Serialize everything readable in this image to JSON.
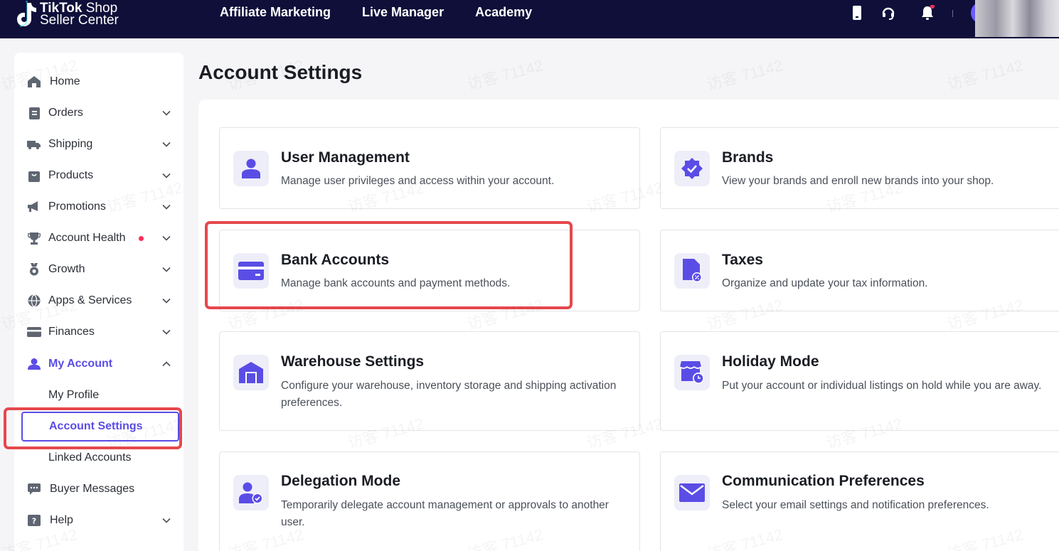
{
  "header": {
    "logo_line1_bold": "TikTok",
    "logo_line1_rest": " Shop",
    "logo_line2": "Seller Center",
    "nav": [
      "Affiliate Marketing",
      "Live Manager",
      "Academy"
    ],
    "icons": [
      "phone-icon",
      "headset-icon",
      "bell-icon"
    ],
    "colors": {
      "bar": "#0f0f3a",
      "accent": "#5a4de6",
      "alert": "#fe2c55"
    }
  },
  "sidebar": {
    "items": [
      {
        "label": "Home",
        "icon": "home-icon",
        "chevron": false
      },
      {
        "label": "Orders",
        "icon": "orders-icon",
        "chevron": "down"
      },
      {
        "label": "Shipping",
        "icon": "truck-icon",
        "chevron": "down"
      },
      {
        "label": "Products",
        "icon": "bag-icon",
        "chevron": "down"
      },
      {
        "label": "Promotions",
        "icon": "megaphone-icon",
        "chevron": "down"
      },
      {
        "label": "Account Health",
        "icon": "trophy-icon",
        "chevron": "down"
      },
      {
        "label": "Growth",
        "icon": "medal-icon",
        "chevron": "down"
      },
      {
        "label": "Apps & Services",
        "icon": "globe-icon",
        "chevron": "down"
      },
      {
        "label": "Finances",
        "icon": "card-icon",
        "chevron": "down"
      },
      {
        "label": "My Account",
        "icon": "user-icon",
        "chevron": "up"
      }
    ],
    "sub_items": [
      "My Profile",
      "Account Settings",
      "Linked Accounts"
    ],
    "bottom_items": [
      {
        "label": "Buyer Messages",
        "icon": "chat-icon"
      },
      {
        "label": "Help",
        "icon": "help-icon"
      }
    ]
  },
  "main": {
    "title": "Account Settings",
    "cards": [
      {
        "title": "User Management",
        "desc": "Manage user privileges and access within your account.",
        "icon": "user-icon"
      },
      {
        "title": "Brands",
        "desc": "View your brands and enroll new brands into your shop.",
        "icon": "verified-badge-icon"
      },
      {
        "title": "Bank Accounts",
        "desc": "Manage bank accounts and payment methods.",
        "icon": "bank-card-icon"
      },
      {
        "title": "Taxes",
        "desc": "Organize and update your tax information.",
        "icon": "tax-document-icon"
      },
      {
        "title": "Warehouse Settings",
        "desc": "Configure your warehouse, inventory storage and shipping activation preferences.",
        "icon": "warehouse-icon"
      },
      {
        "title": "Holiday Mode",
        "desc": "Put your account or individual listings on hold while you are away.",
        "icon": "store-clock-icon"
      },
      {
        "title": "Delegation Mode",
        "desc": "Temporarily delegate account management or approvals to another user.",
        "icon": "user-check-icon"
      },
      {
        "title": "Communication Preferences",
        "desc": "Select your email settings and notification preferences.",
        "icon": "envelope-icon"
      }
    ]
  },
  "watermark": "访客 71142"
}
